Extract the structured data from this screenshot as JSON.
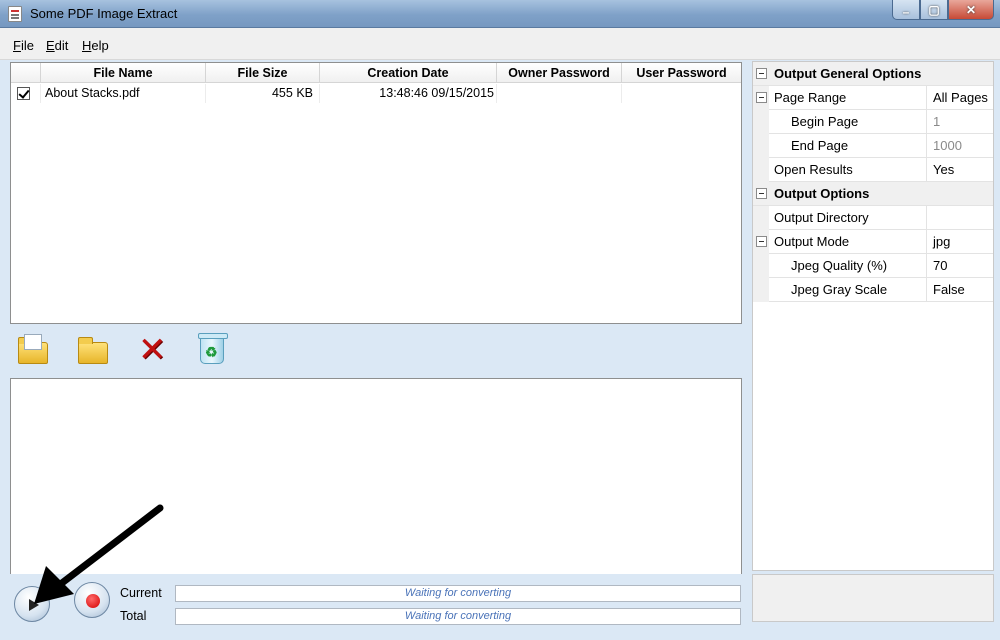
{
  "window": {
    "title": "Some PDF Image Extract",
    "controls": {
      "minimize": "–",
      "maximize": "▢",
      "close": "✕"
    }
  },
  "menu": {
    "file": "File",
    "edit": "Edit",
    "help": "Help"
  },
  "file_table": {
    "columns": [
      "File Name",
      "File Size",
      "Creation Date",
      "Owner Password",
      "User Password"
    ],
    "rows": [
      {
        "checked": true,
        "name": "About Stacks.pdf",
        "size": "455 KB",
        "created": "13:48:46 09/15/2015",
        "owner_password": "",
        "user_password": ""
      }
    ]
  },
  "toolbar": {
    "icons": [
      "add-file-icon",
      "add-folder-icon",
      "remove-icon",
      "clear-list-icon"
    ],
    "remove_glyph": "✕",
    "recycle_glyph": "♻"
  },
  "options": {
    "general": {
      "title": "Output General Options",
      "page_range": {
        "label": "Page Range",
        "value": "All Pages"
      },
      "begin_page": {
        "label": "Begin Page",
        "value": "1"
      },
      "end_page": {
        "label": "End Page",
        "value": "1000"
      },
      "open_results": {
        "label": "Open Results",
        "value": "Yes"
      }
    },
    "output": {
      "title": "Output Options",
      "directory": {
        "label": "Output Directory",
        "value": ""
      },
      "mode": {
        "label": "Output Mode",
        "value": "jpg"
      },
      "jpeg_quality": {
        "label": "Jpeg Quality (%)",
        "value": "70"
      },
      "jpeg_gray": {
        "label": "Jpeg Gray Scale",
        "value": "False"
      }
    }
  },
  "status": {
    "current_label": "Current",
    "total_label": "Total",
    "current_text": "Waiting for converting",
    "total_text": "Waiting for converting",
    "current_progress": 0,
    "total_progress": 0
  },
  "colors": {
    "accent": "#dbe8f5",
    "progress_text": "#4a73b8",
    "remove": "#c01010"
  }
}
